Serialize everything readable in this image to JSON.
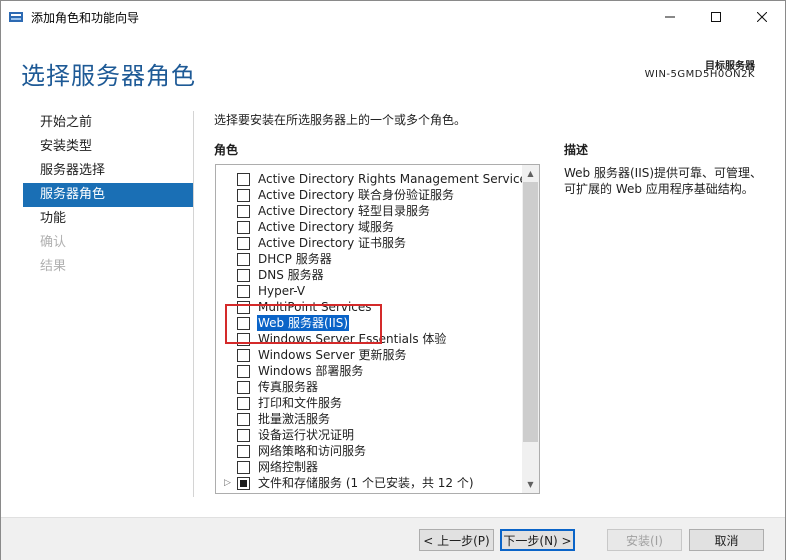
{
  "window": {
    "title": "添加角色和功能向导",
    "controls": {
      "minimize": "minimize",
      "maximize": "maximize",
      "close": "close"
    }
  },
  "header": {
    "title": "选择服务器角色",
    "destination_label": "目标服务器",
    "destination_value": "WIN-5GMD5H0ON2K"
  },
  "nav": {
    "items": [
      {
        "label": "开始之前",
        "state": "normal"
      },
      {
        "label": "安装类型",
        "state": "normal"
      },
      {
        "label": "服务器选择",
        "state": "normal"
      },
      {
        "label": "服务器角色",
        "state": "active"
      },
      {
        "label": "功能",
        "state": "normal"
      },
      {
        "label": "确认",
        "state": "disabled"
      },
      {
        "label": "结果",
        "state": "disabled"
      }
    ]
  },
  "content": {
    "instruction": "选择要安装在所选服务器上的一个或多个角色。",
    "roles_header": "角色",
    "description_header": "描述",
    "description_text": "Web 服务器(IIS)提供可靠、可管理、可扩展的 Web 应用程序基础结构。",
    "roles": [
      {
        "label": "Active Directory Rights Management Services",
        "checked": false
      },
      {
        "label": "Active Directory 联合身份验证服务",
        "checked": false
      },
      {
        "label": "Active Directory 轻型目录服务",
        "checked": false
      },
      {
        "label": "Active Directory 域服务",
        "checked": false
      },
      {
        "label": "Active Directory 证书服务",
        "checked": false
      },
      {
        "label": "DHCP 服务器",
        "checked": false
      },
      {
        "label": "DNS 服务器",
        "checked": false
      },
      {
        "label": "Hyper-V",
        "checked": false
      },
      {
        "label": "MultiPoint Services",
        "checked": false
      },
      {
        "label": "Web 服务器(IIS)",
        "checked": false,
        "selected": true
      },
      {
        "label": "Windows Server Essentials 体验",
        "checked": false
      },
      {
        "label": "Windows Server 更新服务",
        "checked": false
      },
      {
        "label": "Windows 部署服务",
        "checked": false
      },
      {
        "label": "传真服务器",
        "checked": false
      },
      {
        "label": "打印和文件服务",
        "checked": false
      },
      {
        "label": "批量激活服务",
        "checked": false
      },
      {
        "label": "设备运行状况证明",
        "checked": false
      },
      {
        "label": "网络策略和访问服务",
        "checked": false
      },
      {
        "label": "网络控制器",
        "checked": false
      },
      {
        "label": "文件和存储服务 (1 个已安装，共 12 个)",
        "checked": "partial",
        "expandable": true
      }
    ]
  },
  "footer": {
    "prev_label": "< 上一步(P)",
    "next_label": "下一步(N) >",
    "install_label": "安装(I)",
    "cancel_label": "取消"
  },
  "colors": {
    "accent": "#1a6fb5",
    "title_blue": "#1e5a96",
    "selection": "#0a64c8",
    "highlight_border": "#d42a2a"
  }
}
